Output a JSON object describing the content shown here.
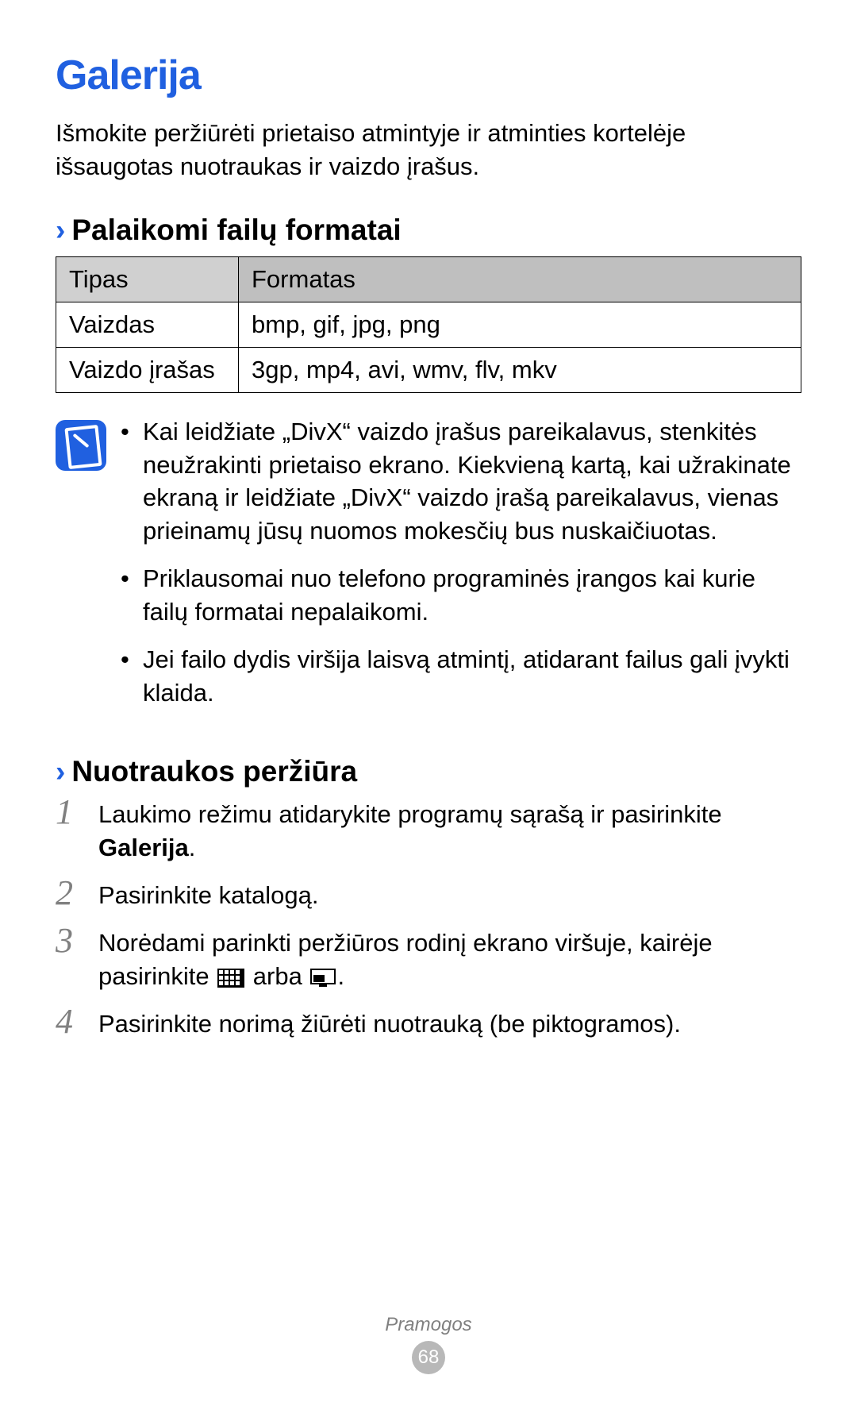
{
  "title": "Galerija",
  "intro": "Išmokite peržiūrėti prietaiso atmintyje ir atminties kortelėje išsaugotas nuotraukas ir vaizdo įrašus.",
  "section1": {
    "chevron": "›",
    "title": "Palaikomi failų formatai",
    "table": {
      "head": {
        "c1": "Tipas",
        "c2": "Formatas"
      },
      "rows": [
        {
          "c1": "Vaizdas",
          "c2": "bmp, gif, jpg, png"
        },
        {
          "c1": "Vaizdo įrašas",
          "c2": "3gp, mp4, avi, wmv, flv, mkv"
        }
      ]
    },
    "notes": [
      "Kai leidžiate „DivX“ vaizdo įrašus pareikalavus, stenkitės neužrakinti prietaiso ekrano. Kiekvieną kartą, kai užrakinate ekraną ir leidžiate „DivX“ vaizdo įrašą pareikalavus, vienas prieinamų jūsų nuomos mokesčių bus nuskaičiuotas.",
      "Priklausomai nuo telefono programinės įrangos kai kurie failų formatai nepalaikomi.",
      "Jei failo dydis viršija laisvą atmintį, atidarant failus gali įvykti klaida."
    ]
  },
  "section2": {
    "chevron": "›",
    "title": "Nuotraukos peržiūra",
    "steps": [
      {
        "num": "1",
        "pre": "Laukimo režimu atidarykite programų sąrašą ir pasirinkite ",
        "bold": "Galerija",
        "post": "."
      },
      {
        "num": "2",
        "pre": "Pasirinkite katalogą.",
        "bold": "",
        "post": ""
      },
      {
        "num": "3",
        "pre": "Norėdami parinkti peržiūros rodinį ekrano viršuje, kairėje pasirinkite ",
        "mid": " arba ",
        "post": "."
      },
      {
        "num": "4",
        "pre": "Pasirinkite norimą žiūrėti nuotrauką (be piktogramos).",
        "bold": "",
        "post": ""
      }
    ]
  },
  "footer": {
    "section": "Pramogos",
    "page": "68"
  }
}
